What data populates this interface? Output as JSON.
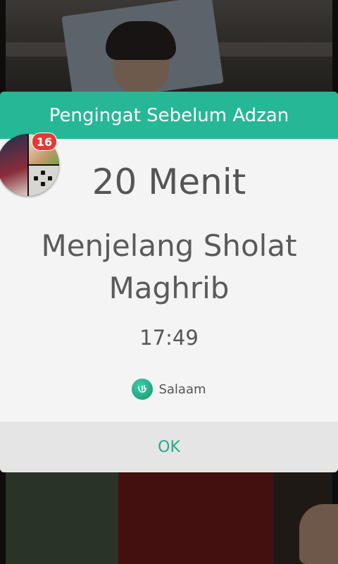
{
  "dialog": {
    "title": "Pengingat Sebelum Adzan",
    "minutes_text": "20 Menit",
    "prayer_text": "Menjelang Sholat Maghrib",
    "time": "17:49",
    "app_name": "Salaam",
    "ok_label": "OK"
  },
  "chathead": {
    "badge_count": "16"
  },
  "colors": {
    "header": "#26b896",
    "ok_text": "#26a888",
    "badge": "#e53935"
  },
  "icons": [
    "salaam-app-icon",
    "chathead-avatar"
  ]
}
